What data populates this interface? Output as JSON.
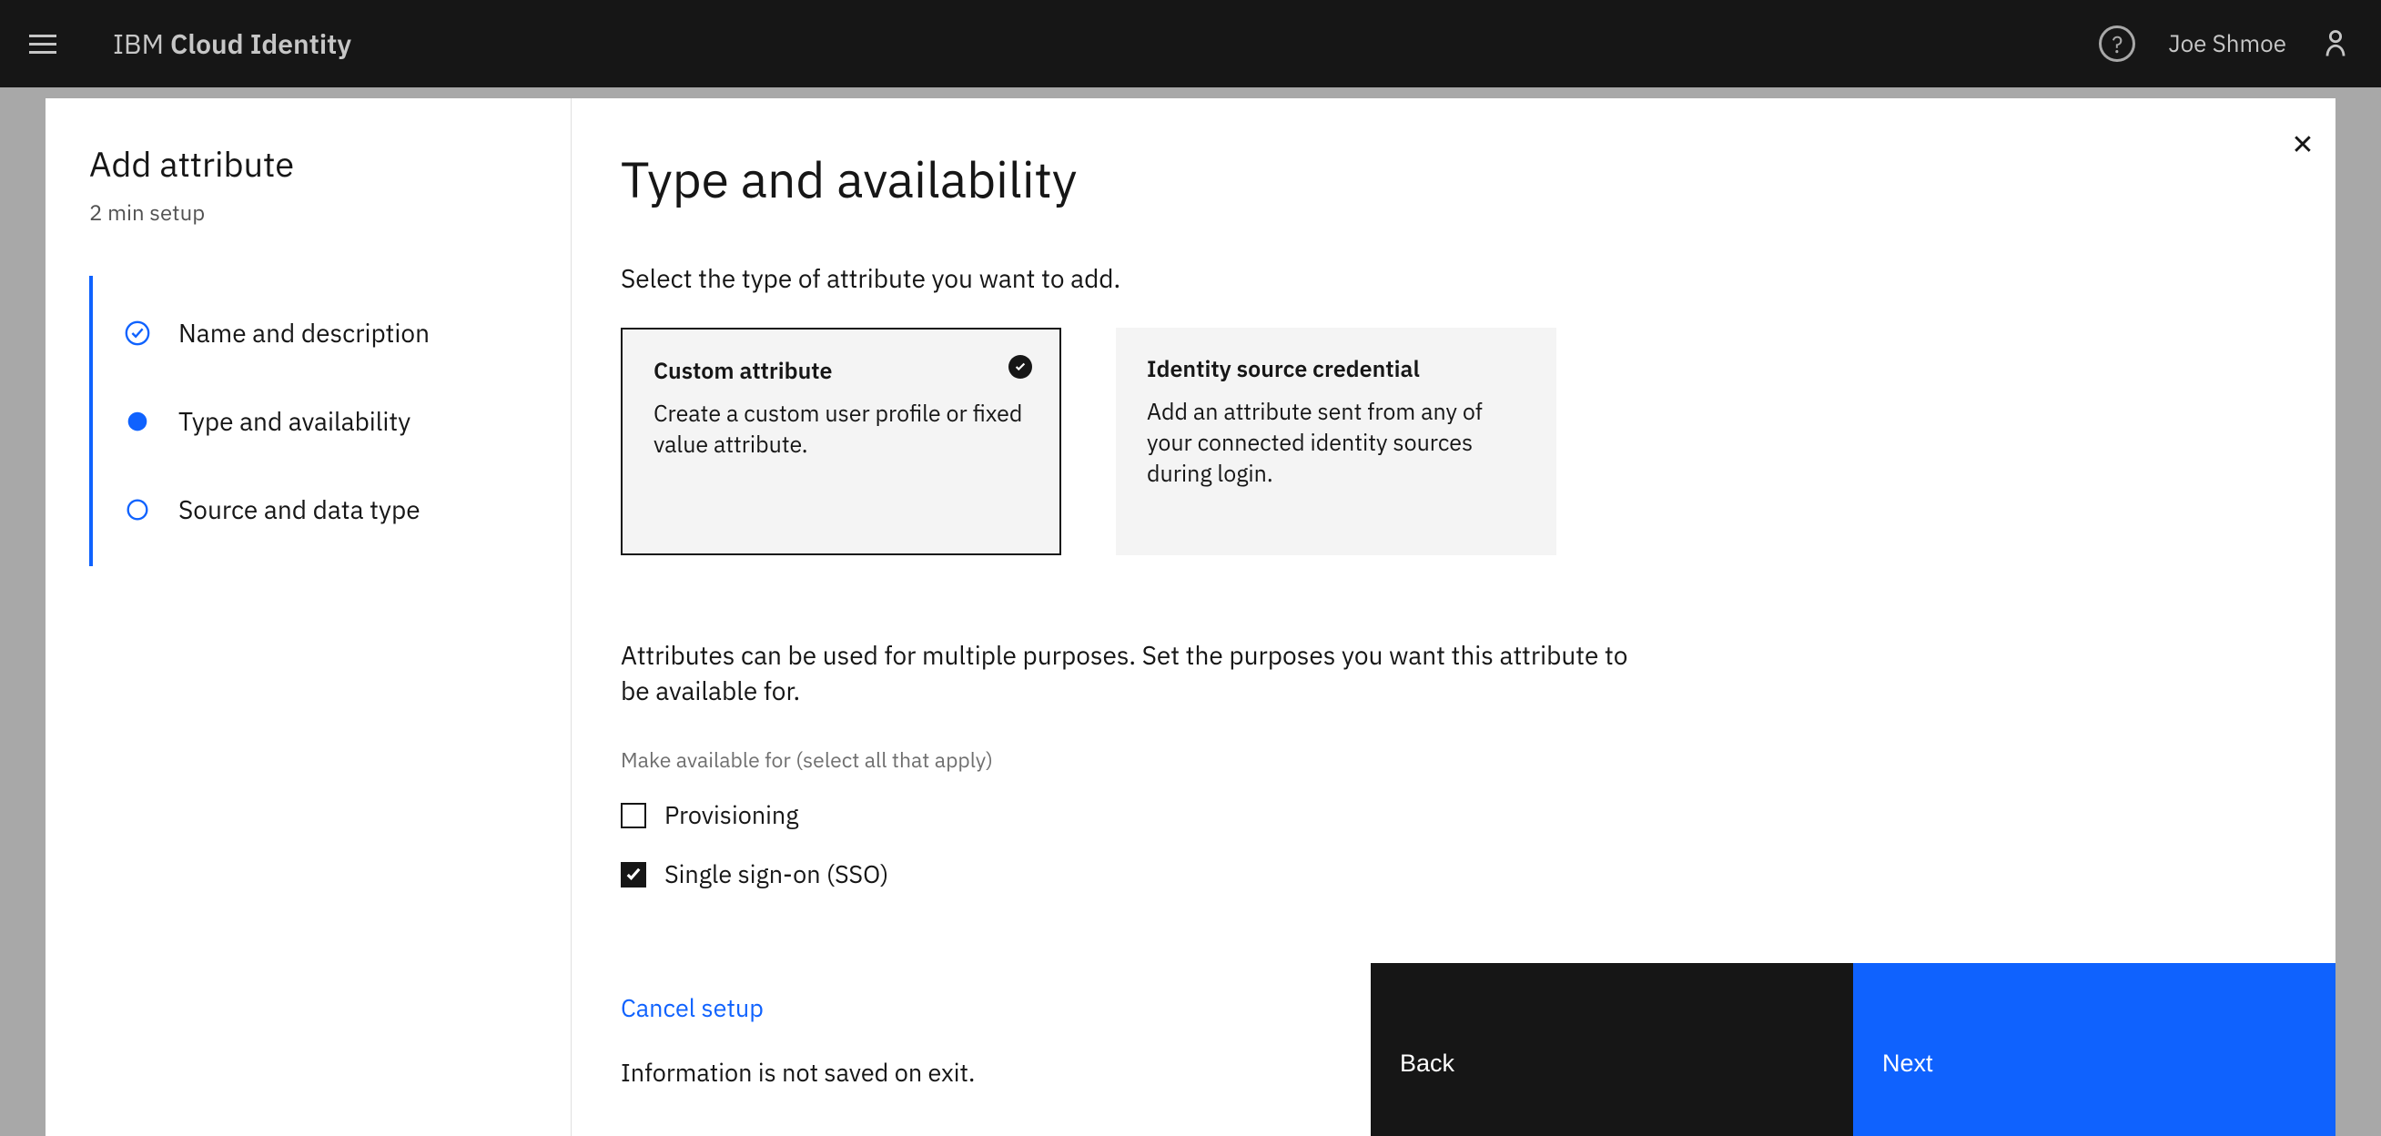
{
  "header": {
    "brand_prefix": "IBM ",
    "brand_suffix": "Cloud Identity",
    "user_name": "Joe Shmoe"
  },
  "sidebar": {
    "title": "Add attribute",
    "subtitle": "2 min setup",
    "steps": [
      {
        "label": "Name and description",
        "state": "complete"
      },
      {
        "label": "Type and availability",
        "state": "current"
      },
      {
        "label": "Source and data type",
        "state": "incomplete"
      }
    ]
  },
  "main": {
    "title": "Type and availability",
    "instruction1": "Select the type of attribute you want to add.",
    "tiles": [
      {
        "title": "Custom attribute",
        "desc": "Create a custom user profile or fixed value attribute.",
        "selected": true
      },
      {
        "title": "Identity source credential",
        "desc": "Add an attribute sent from any of your connected identity sources during login.",
        "selected": false
      }
    ],
    "instruction2": "Attributes can be used for multiple purposes. Set the purposes you want this attribute to be available for.",
    "helper_text": "Make available for (select all that apply)",
    "checkboxes": [
      {
        "label": "Provisioning",
        "checked": false
      },
      {
        "label": "Single sign-on (SSO)",
        "checked": true
      }
    ]
  },
  "footer": {
    "cancel_label": "Cancel setup",
    "save_note": "Information is not saved on exit.",
    "back_label": "Back",
    "next_label": "Next"
  }
}
